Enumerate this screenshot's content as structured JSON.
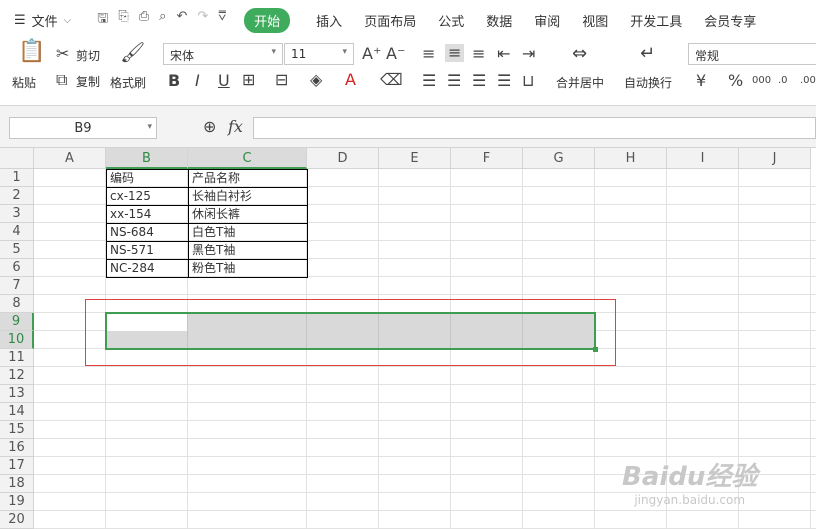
{
  "menu": {
    "file_label": "文件",
    "tabs": [
      {
        "label": "开始",
        "active": true
      },
      {
        "label": "插入"
      },
      {
        "label": "页面布局"
      },
      {
        "label": "公式"
      },
      {
        "label": "数据"
      },
      {
        "label": "审阅"
      },
      {
        "label": "视图"
      },
      {
        "label": "开发工具"
      },
      {
        "label": "会员专享"
      }
    ],
    "accent_color": "#3eac5c"
  },
  "ribbon": {
    "paste": "粘贴",
    "cut": "剪切",
    "copy": "复制",
    "format_painter": "格式刷",
    "font_name": "宋体",
    "font_size": "11",
    "merge_center": "合并居中",
    "wrap_text": "自动换行",
    "number_format": "常规"
  },
  "formula_bar": {
    "name_box": "B9",
    "fx": "fx"
  },
  "sheet": {
    "columns": [
      "A",
      "B",
      "C",
      "D",
      "E",
      "F",
      "G",
      "H",
      "I",
      "J"
    ],
    "rows": [
      "1",
      "2",
      "3",
      "4",
      "5",
      "6",
      "7",
      "8",
      "9",
      "10",
      "11",
      "12",
      "13",
      "14",
      "15",
      "16",
      "17",
      "18",
      "19",
      "20"
    ],
    "table_header": [
      "编码",
      "产品名称"
    ],
    "table_rows": [
      [
        "cx-125",
        "长袖白衬衫"
      ],
      [
        "xx-154",
        "休闲长裤"
      ],
      [
        "NS-684",
        "白色T袖"
      ],
      [
        "NS-571",
        "黑色T袖"
      ],
      [
        "NC-284",
        "粉色T袖"
      ]
    ],
    "selection": "B9"
  },
  "watermark": {
    "text": "Baidu经验",
    "url": "jingyan.baidu.com"
  }
}
